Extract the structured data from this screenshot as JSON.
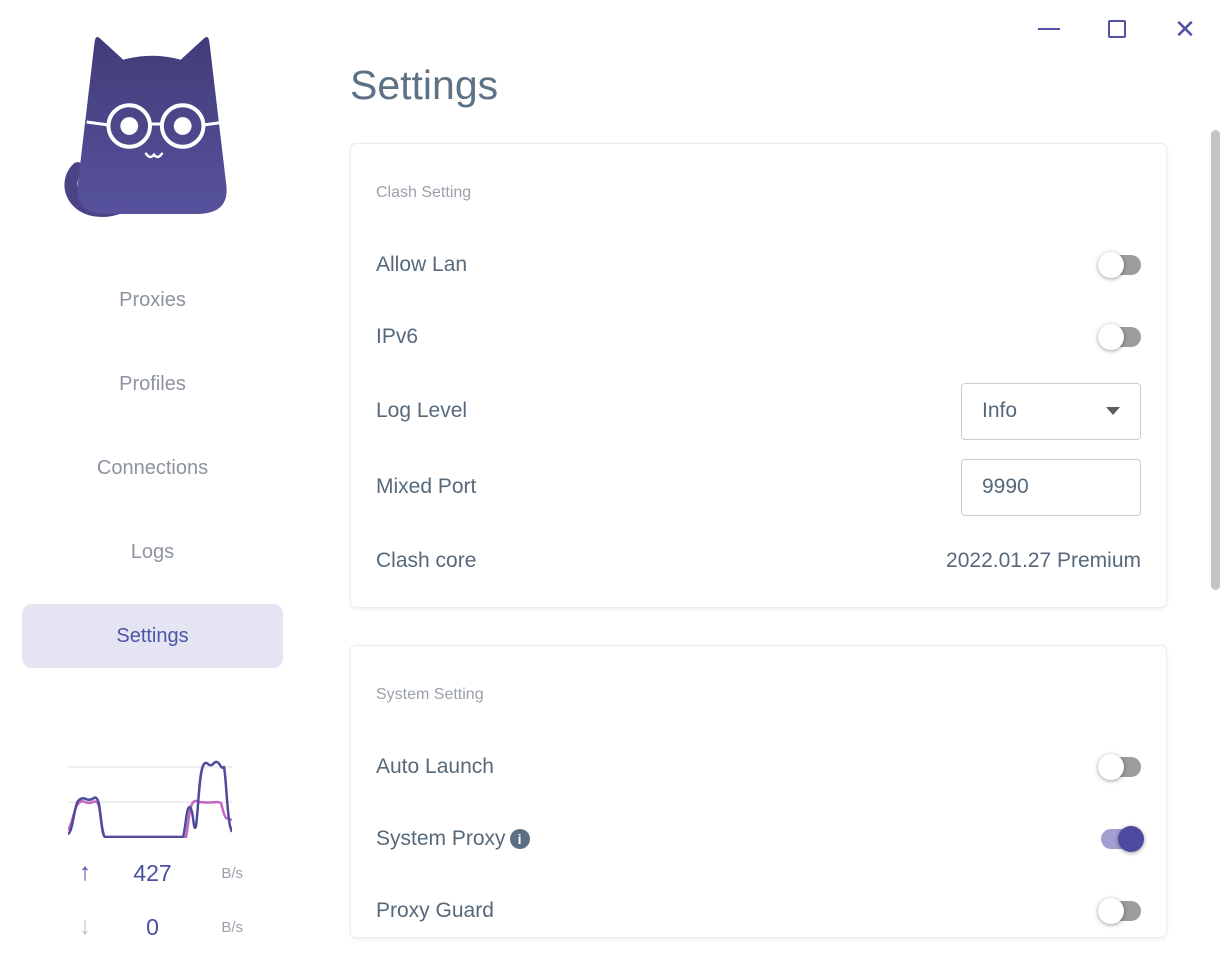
{
  "window": {
    "controls": {
      "minimize": "minimize",
      "maximize": "maximize",
      "close": "close"
    }
  },
  "icons": {
    "close": "✕",
    "arrow_up": "↑",
    "arrow_down": "↓",
    "info": "i"
  },
  "sidebar": {
    "logo": "clash-cat-logo",
    "items": [
      {
        "label": "Proxies",
        "active": false
      },
      {
        "label": "Profiles",
        "active": false
      },
      {
        "label": "Connections",
        "active": false
      },
      {
        "label": "Logs",
        "active": false
      },
      {
        "label": "Settings",
        "active": true
      }
    ],
    "traffic": {
      "chart": {
        "type": "line",
        "series": [
          {
            "name": "upload",
            "color": "#4f4b9b",
            "shape": "two bumps: small plateau at left ~40% height, flat zero middle, tall wavy peak at right ~90% height"
          },
          {
            "name": "download",
            "color": "#c566c4",
            "shape": "small plateau at left ~40% height, flat zero middle, plateau at right ~45% height ending mid-level"
          }
        ],
        "gridline_color": "#e9e9e9"
      },
      "up": {
        "value": "427",
        "unit": "B/s"
      },
      "down": {
        "value": "0",
        "unit": "B/s"
      }
    }
  },
  "main": {
    "title": "Settings",
    "cards": [
      {
        "section": "Clash Setting",
        "rows": [
          {
            "label": "Allow Lan",
            "control": "toggle",
            "state": "off"
          },
          {
            "label": "IPv6",
            "control": "toggle",
            "state": "off"
          },
          {
            "label": "Log Level",
            "control": "select",
            "value": "Info"
          },
          {
            "label": "Mixed Port",
            "control": "input",
            "value": "9990"
          },
          {
            "label": "Clash core",
            "control": "text",
            "value": "2022.01.27 Premium"
          }
        ]
      },
      {
        "section": "System Setting",
        "rows": [
          {
            "label": "Auto Launch",
            "control": "toggle",
            "state": "off"
          },
          {
            "label": "System Proxy",
            "control": "toggle",
            "state": "on",
            "info": true
          },
          {
            "label": "Proxy Guard",
            "control": "toggle",
            "state": "off"
          }
        ]
      }
    ]
  }
}
